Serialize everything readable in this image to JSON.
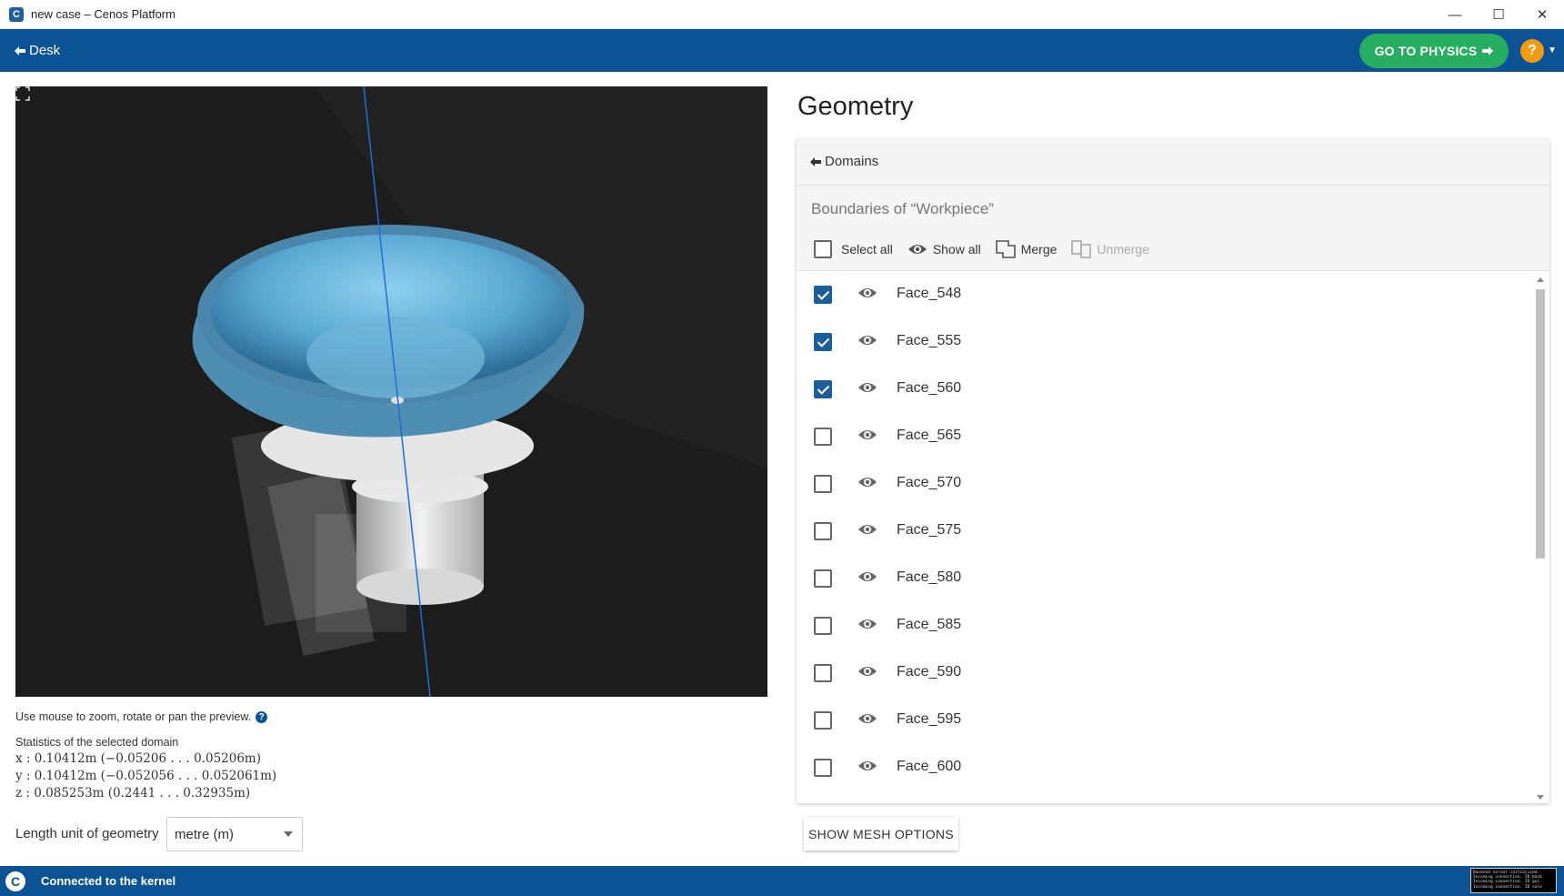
{
  "window": {
    "title": "new case – Cenos Platform",
    "minimize": "—",
    "maximize": "☐",
    "close": "✕"
  },
  "header": {
    "desk_label": "Desk",
    "physics_button": "GO TO PHYSICS",
    "help": "?"
  },
  "viewer": {
    "hint": "Use mouse to zoom, rotate or pan the preview.",
    "stats_title": "Statistics of the selected domain",
    "stats": [
      "x : 0.10412m (−0.05206 . . . 0.05206m)",
      "y : 0.10412m (−0.052056 . . . 0.052061m)",
      "z : 0.085253m (0.2441 . . . 0.32935m)"
    ],
    "unit_label": "Length unit of geometry",
    "unit_value": "metre (m)"
  },
  "panel": {
    "title": "Geometry",
    "domains_link": "Domains",
    "boundaries_title": "Boundaries of “Workpiece”",
    "toolbar": {
      "select_all": "Select all",
      "show_all": "Show all",
      "merge": "Merge",
      "unmerge": "Unmerge"
    },
    "faces": [
      {
        "label": "Face_548",
        "checked": true
      },
      {
        "label": "Face_555",
        "checked": true
      },
      {
        "label": "Face_560",
        "checked": true
      },
      {
        "label": "Face_565",
        "checked": false
      },
      {
        "label": "Face_570",
        "checked": false
      },
      {
        "label": "Face_575",
        "checked": false
      },
      {
        "label": "Face_580",
        "checked": false
      },
      {
        "label": "Face_585",
        "checked": false
      },
      {
        "label": "Face_590",
        "checked": false
      },
      {
        "label": "Face_595",
        "checked": false
      },
      {
        "label": "Face_600",
        "checked": false
      }
    ],
    "mesh_button": "SHOW MESH OPTIONS"
  },
  "status": {
    "text": "Connected to the kernel",
    "console_lines": [
      "Backend server initialized.",
      "Incoming connection. ID back",
      "Incoming connection. ID gui",
      "Incoming connection. ID sale"
    ]
  },
  "colors": {
    "primary": "#0b5394",
    "physics": "#27ae60",
    "help": "#f39c12",
    "checkbox": "#1a5e9c"
  }
}
